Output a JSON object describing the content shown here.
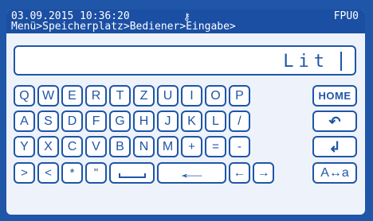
{
  "status_bar": {
    "datetime": "03.09.2015 10:36:20",
    "device_id": "FPU0",
    "breadcrumb": "Menü>Speicherplatz>Bediener>Eingabe>",
    "key_icon": "key-icon"
  },
  "entry": {
    "value": "Lit"
  },
  "keys": {
    "row1": [
      "Q",
      "W",
      "E",
      "R",
      "T",
      "Z",
      "U",
      "I",
      "O",
      "P"
    ],
    "row2": [
      "A",
      "S",
      "D",
      "F",
      "G",
      "H",
      "J",
      "K",
      "L",
      "/"
    ],
    "row3": [
      "Y",
      "X",
      "C",
      "V",
      "B",
      "N",
      "M",
      "+",
      "=",
      "-"
    ],
    "row4": [
      ">",
      "<",
      "*",
      "\""
    ],
    "space": "space-key",
    "backspace": "←",
    "left": "←",
    "right": "→",
    "home": "HOME",
    "undo": "↶",
    "enter": "↲",
    "case": "A↔a"
  },
  "colors": {
    "accent": "#1f56a8",
    "screen_bg": "#eef2fb",
    "key_bg": "#ffffff"
  }
}
